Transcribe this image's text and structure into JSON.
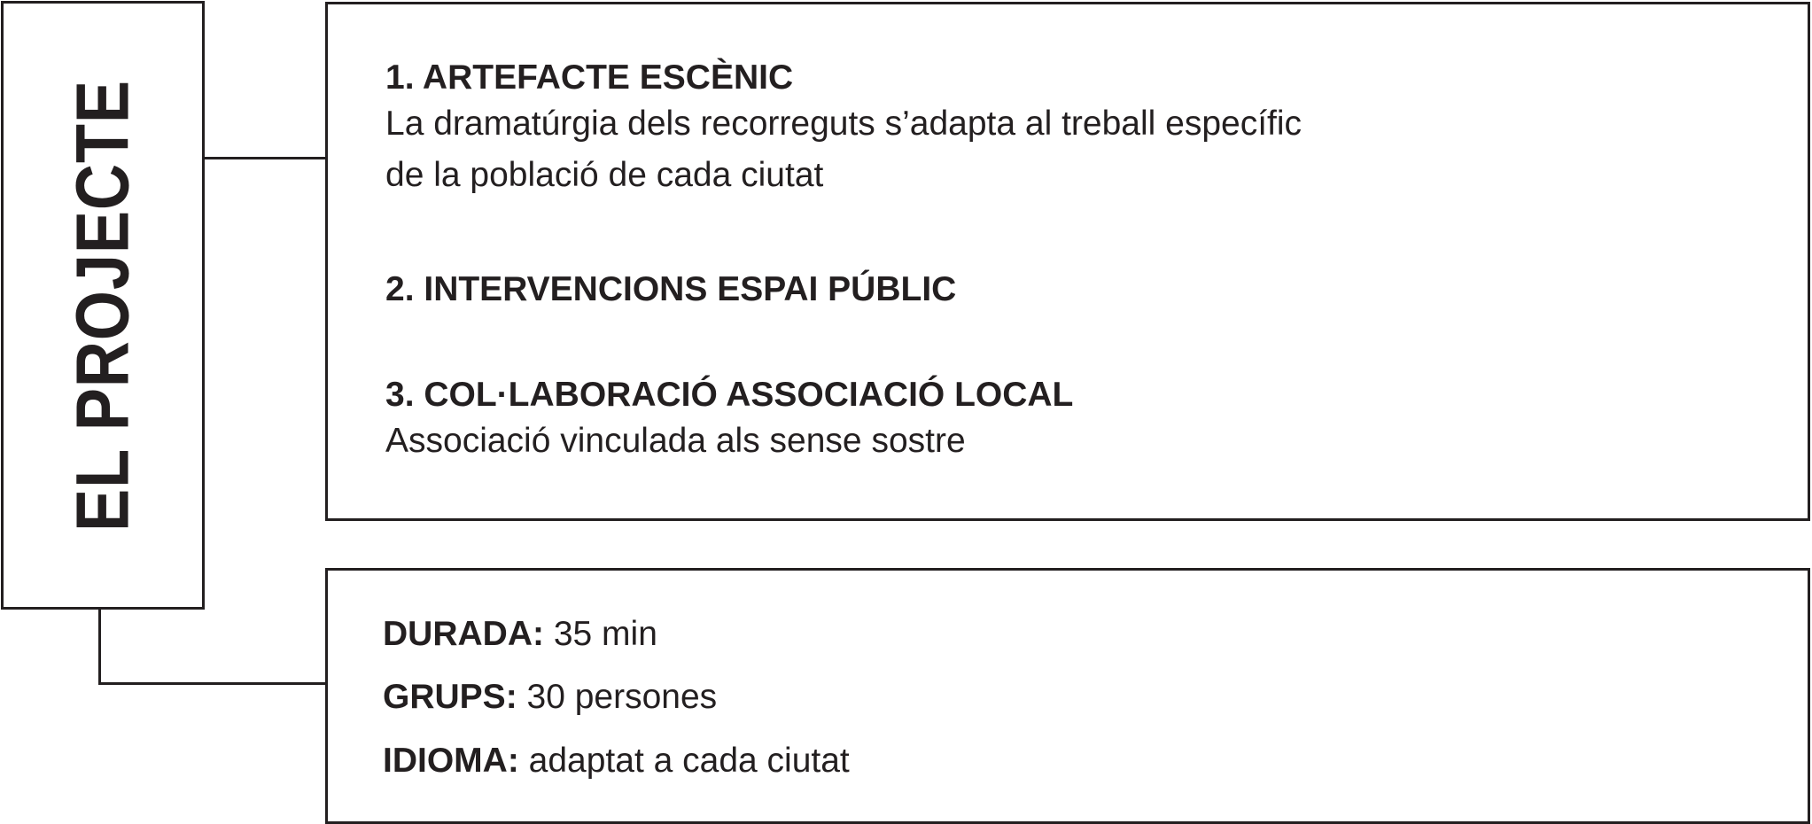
{
  "title": "EL PROJECTE",
  "items": [
    {
      "heading": "1. ARTEFACTE ESCÈNIC",
      "description_lines": [
        "La dramatúrgia dels recorreguts s’adapta al treball específic",
        "de la població de cada ciutat"
      ]
    },
    {
      "heading": "2. INTERVENCIONS ESPAI PÚBLIC",
      "description_lines": []
    },
    {
      "heading": "3. COL·LABORACIÓ ASSOCIACIÓ LOCAL",
      "description_lines": [
        "Associació vinculada als sense sostre"
      ]
    }
  ],
  "details": [
    {
      "label": "DURADA:",
      "value": "35 min"
    },
    {
      "label": "GRUPS:",
      "value": "30 persones"
    },
    {
      "label": "IDIOMA:",
      "value": "adaptat a cada ciutat"
    }
  ],
  "colors": {
    "ink": "#231f20",
    "background": "#ffffff"
  }
}
